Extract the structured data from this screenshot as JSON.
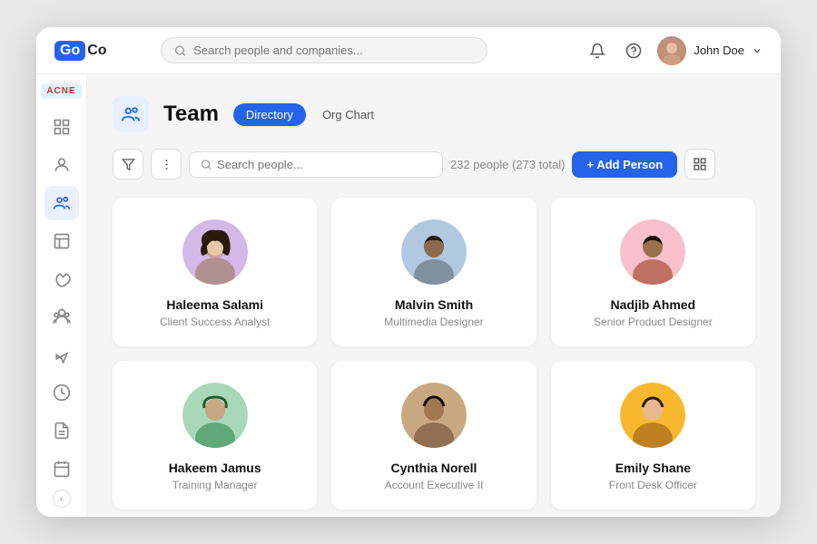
{
  "header": {
    "logo_go": "Go",
    "logo_co": "Co",
    "search_placeholder": "Search people and companies...",
    "user_name": "John Doe",
    "bell_icon": "🔔",
    "help_icon": "?"
  },
  "sidebar": {
    "acme_label": "ACNE",
    "items": [
      {
        "id": "monitor",
        "icon": "🖥",
        "label": "Dashboard"
      },
      {
        "id": "person",
        "icon": "👤",
        "label": "Profile"
      },
      {
        "id": "team",
        "icon": "👥",
        "label": "Team",
        "active": true
      },
      {
        "id": "chart",
        "icon": "📊",
        "label": "Reports"
      },
      {
        "id": "umbrella",
        "icon": "☂",
        "label": "Benefits"
      },
      {
        "id": "people2",
        "icon": "🧑‍🤝‍🧑",
        "label": "People"
      },
      {
        "id": "plane",
        "icon": "✈",
        "label": "Time Off"
      },
      {
        "id": "clock",
        "icon": "🕐",
        "label": "Time"
      },
      {
        "id": "doc",
        "icon": "📄",
        "label": "Documents"
      },
      {
        "id": "calendar",
        "icon": "📅",
        "label": "Calendar"
      }
    ],
    "collapse_icon": "‹"
  },
  "page": {
    "icon": "👥",
    "title": "Team",
    "tabs": [
      {
        "label": "Directory",
        "active": true
      },
      {
        "label": "Org Chart",
        "active": false
      }
    ]
  },
  "toolbar": {
    "filter_icon": "▼",
    "options_icon": "⋮",
    "search_placeholder": "Search people...",
    "people_count": "232 people (273 total)",
    "add_btn_label": "+ Add Person",
    "grid_icon": "⊞"
  },
  "people": [
    {
      "id": "haleema",
      "name": "Haleema Salami",
      "role": "Client Success Analyst",
      "avatar_color": "#d0b8e8",
      "avatar_bg": "#c9b0d8"
    },
    {
      "id": "malvin",
      "name": "Malvin Smith",
      "role": "Multimedia Designer",
      "avatar_color": "#a0b8d8",
      "avatar_bg": "#90a8c8"
    },
    {
      "id": "nadjib",
      "name": "Nadjib Ahmed",
      "role": "Senior Product Designer",
      "avatar_color": "#f8b8c0",
      "avatar_bg": "#e8a0b0"
    },
    {
      "id": "hakeem",
      "name": "Hakeem Jamus",
      "role": "Training Manager",
      "avatar_color": "#a8d8b8",
      "avatar_bg": "#88c8a0"
    },
    {
      "id": "cynthia",
      "name": "Cynthia Norell",
      "role": "Account Executive II",
      "avatar_color": "#c8a880",
      "avatar_bg": "#b89870"
    },
    {
      "id": "emily",
      "name": "Emily Shane",
      "role": "Front Desk Officer",
      "avatar_color": "#f8b830",
      "avatar_bg": "#e8a820"
    }
  ]
}
